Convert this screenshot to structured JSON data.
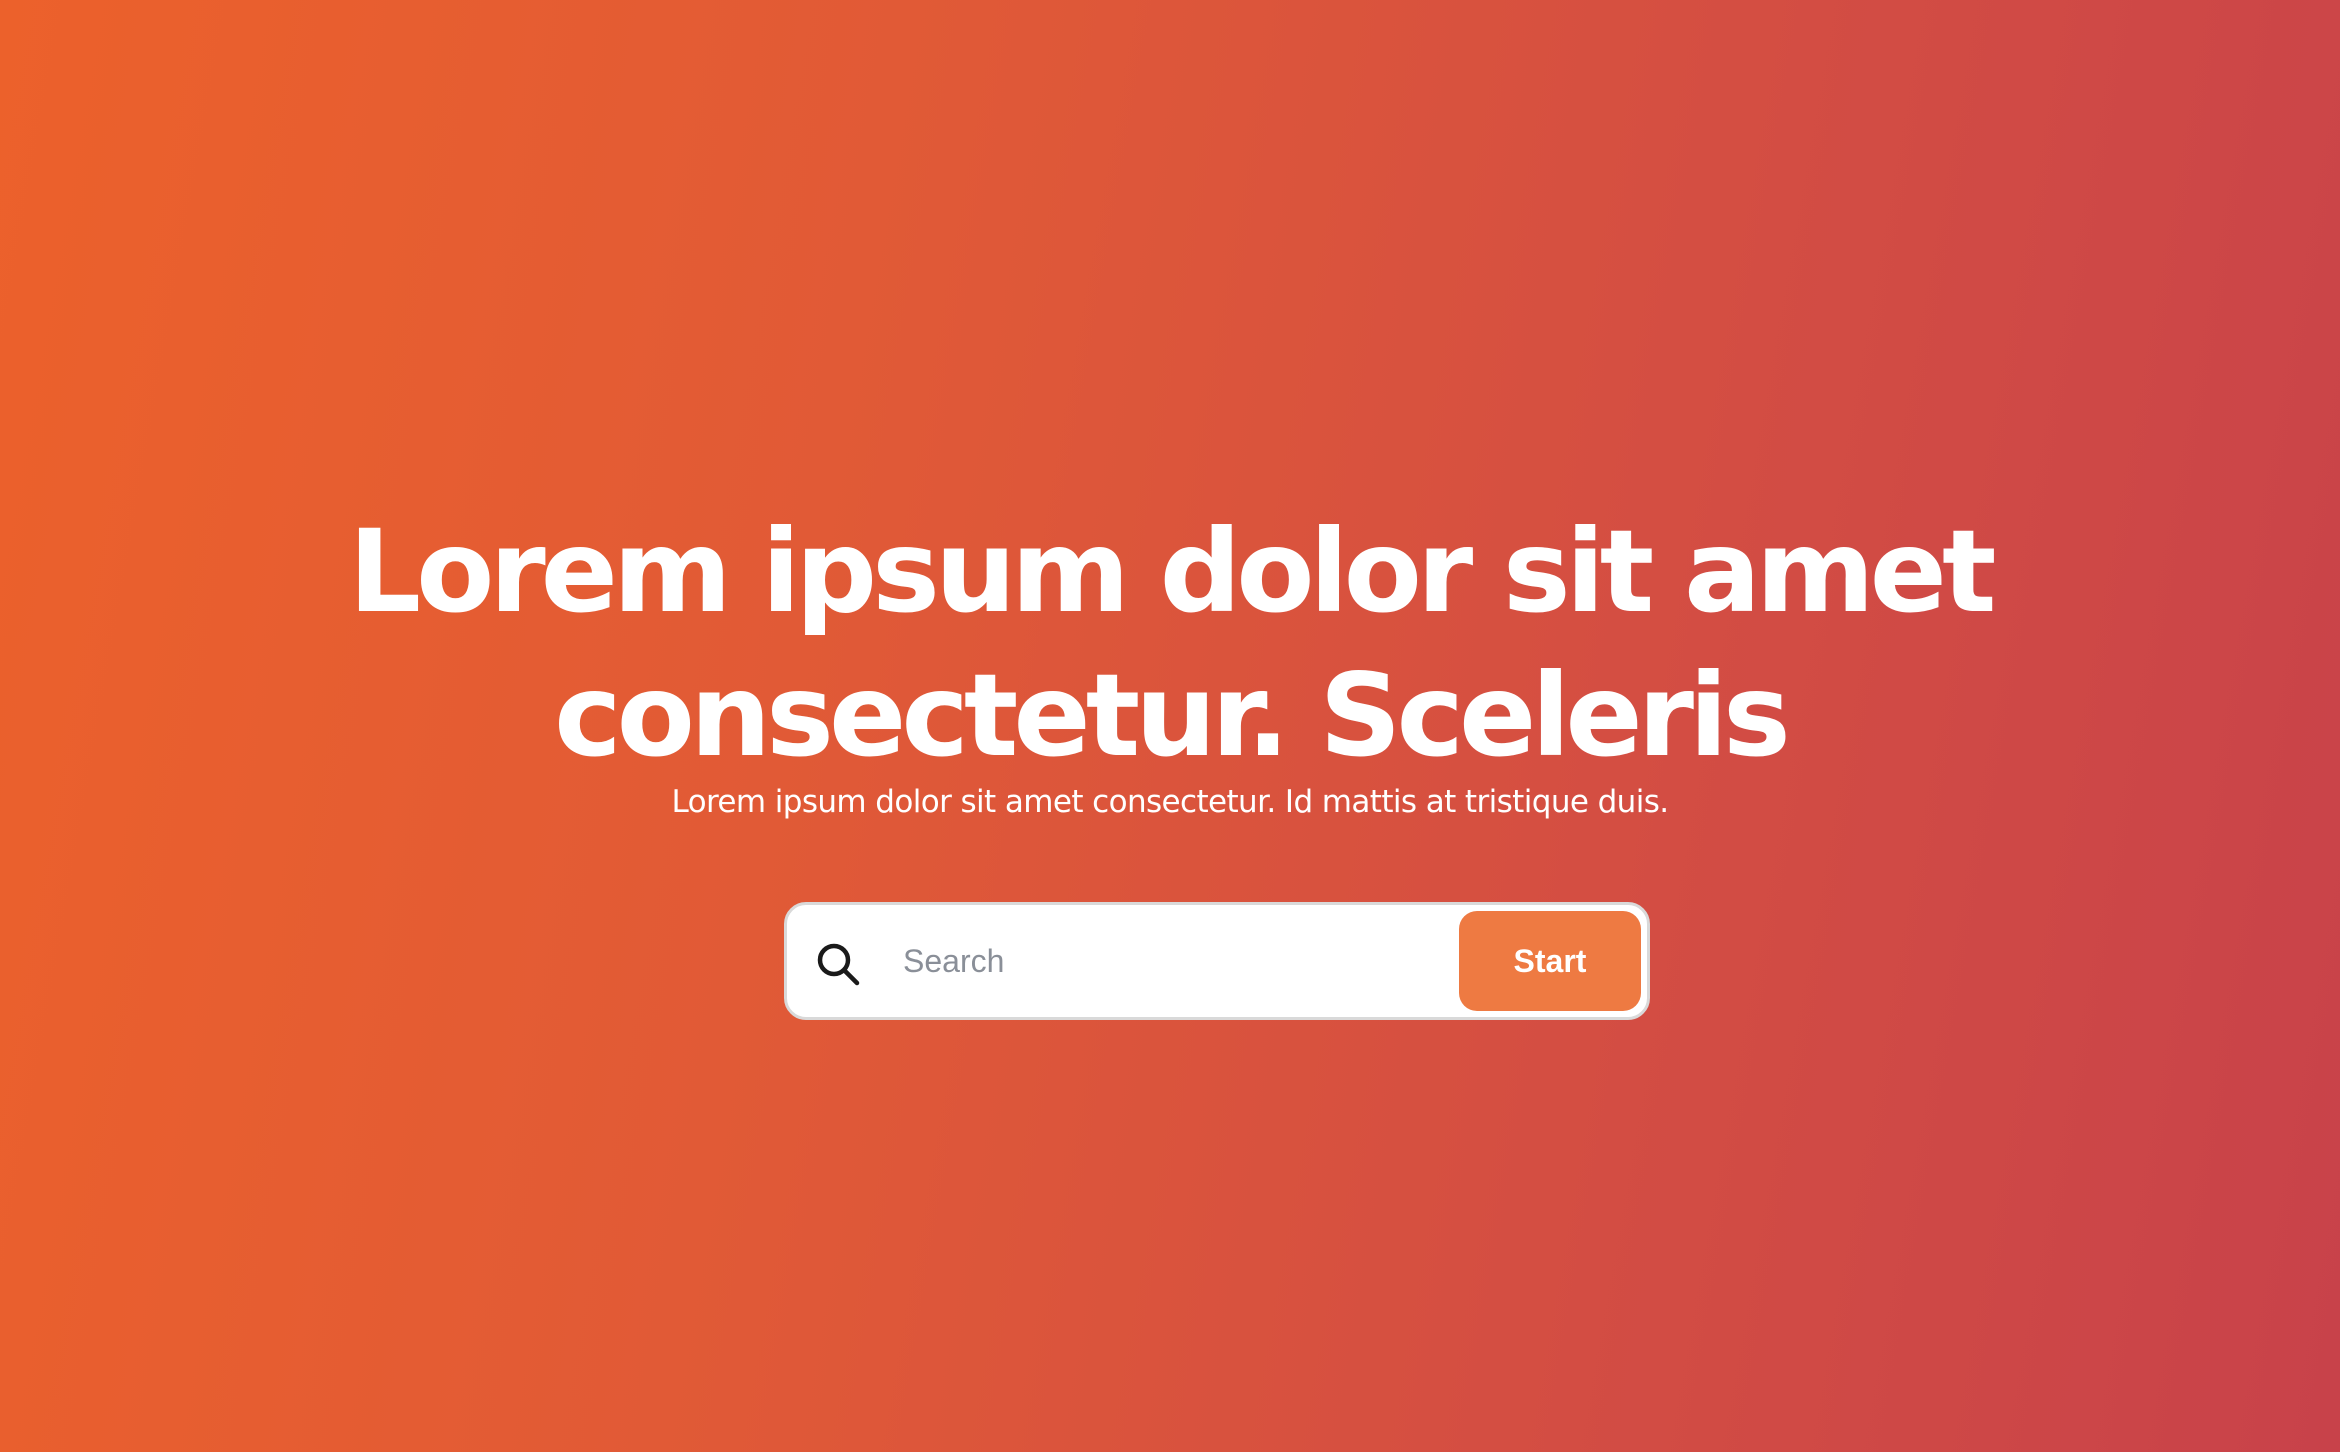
{
  "hero": {
    "title_line1": "Lorem ipsum dolor sit amet",
    "title_line2": "consectetur. Sceleris",
    "subtitle": "Lorem ipsum dolor sit amet consectetur. Id mattis at tristique duis."
  },
  "search": {
    "icon": "search-icon",
    "placeholder": "Search",
    "value": "",
    "button_label": "Start"
  },
  "colors": {
    "gradient_start": "#ec612b",
    "gradient_end": "#c8424a",
    "button": "#ee7a42",
    "text": "#ffffff"
  }
}
